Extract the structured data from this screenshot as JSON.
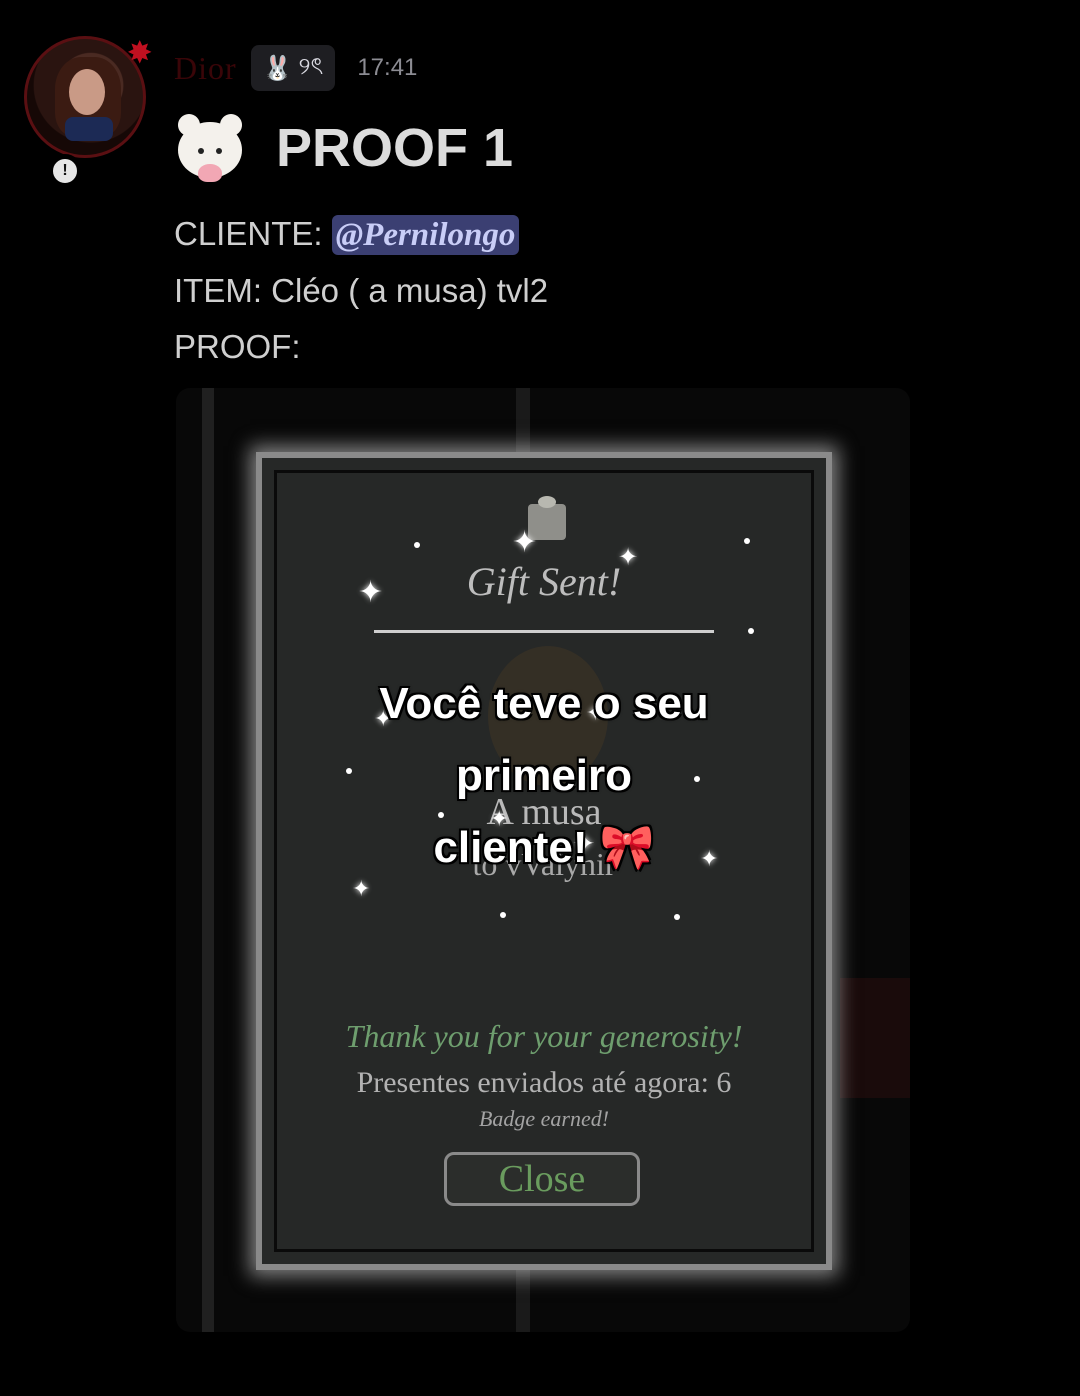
{
  "message": {
    "username": "Dior",
    "tag_text": "୨ৎ",
    "timestamp": "17:41",
    "title": "PROOF 1",
    "client_label": "CLIENTE: ",
    "client_mention": "@Pernilongo",
    "item_line": "ITEM: Cléo ( a musa) tvl2",
    "proof_label": "PROOF:"
  },
  "icons": {
    "anger": "anger-icon",
    "bunny": "bunny-icon",
    "bear": "bear-icon",
    "gift": "gift-icon",
    "bow": "bow-icon"
  },
  "proof_dialog": {
    "heading": "Gift Sent!",
    "overlay_line1": "Você teve o seu primeiro",
    "overlay_line2": "cliente!",
    "item_name": "A musa",
    "recipient": "to vValynir",
    "thanks": "Thank you for your generosity!",
    "gifts_sent": "Presentes enviados até agora: 6",
    "badge": "Badge earned!",
    "close_label": "Close"
  },
  "colors": {
    "background": "#000000",
    "mention_bg": "#3b3f72",
    "thanks_green": "#6e9e6e",
    "username_dark_red": "#3a0508"
  }
}
